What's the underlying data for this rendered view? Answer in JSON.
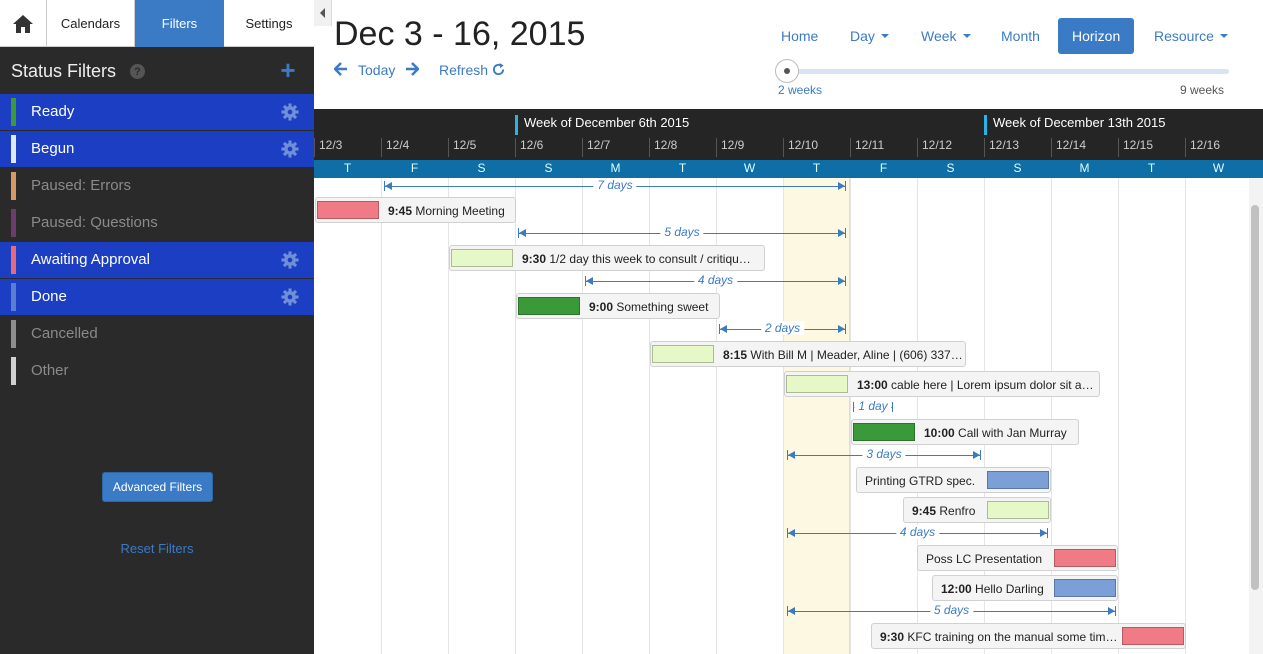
{
  "sidebar": {
    "tabs": {
      "calendars": "Calendars",
      "filters": "Filters",
      "settings": "Settings"
    },
    "status_title": "Status Filters",
    "filters": [
      {
        "label": "Ready",
        "color": "#3a9a3a",
        "active": true
      },
      {
        "label": "Begun",
        "color": "#dfe9f5",
        "active": true
      },
      {
        "label": "Paused: Errors",
        "color": "#d59a64",
        "active": false
      },
      {
        "label": "Paused: Questions",
        "color": "#6a3d6b",
        "active": false
      },
      {
        "label": "Awaiting Approval",
        "color": "#e66a7a",
        "active": true
      },
      {
        "label": "Done",
        "color": "#5a7fd0",
        "active": true
      },
      {
        "label": "Cancelled",
        "color": "#8e8e8e",
        "active": false
      },
      {
        "label": "Other",
        "color": "#d0d0d0",
        "active": false
      }
    ],
    "advanced_filters": "Advanced Filters",
    "reset_filters": "Reset Filters"
  },
  "header": {
    "date_range": "Dec 3 - 16, 2015",
    "today": "Today",
    "refresh": "Refresh",
    "nav": {
      "home": "Home",
      "day": "Day",
      "week": "Week",
      "month": "Month",
      "horizon": "Horizon",
      "resource": "Resource"
    },
    "slider": {
      "min_label": "2 weeks",
      "max_label": "9 weeks"
    }
  },
  "timeline": {
    "weeks": [
      "Week of December 6th 2015",
      "Week of December 13th 2015"
    ],
    "dates": [
      "12/3",
      "12/4",
      "12/5",
      "12/6",
      "12/7",
      "12/8",
      "12/9",
      "12/10",
      "12/11",
      "12/12",
      "12/13",
      "12/14",
      "12/15",
      "12/16"
    ],
    "days": [
      "T",
      "F",
      "S",
      "S",
      "M",
      "T",
      "W",
      "T",
      "F",
      "S",
      "S",
      "M",
      "T",
      "W"
    ],
    "spans": [
      "7 days",
      "5 days",
      "4 days",
      "2 days",
      "1 day",
      "3 days",
      "4 days",
      "5 days"
    ],
    "events": [
      {
        "time": "9:45",
        "title": "Morning Meeting",
        "color": "#f07a85"
      },
      {
        "time": "9:30",
        "title": "1/2 day this week to consult / critiqu…",
        "color": "#e6f8c8"
      },
      {
        "time": "9:00",
        "title": "Something sweet",
        "color": "#3a9a3a"
      },
      {
        "time": "8:15",
        "title": "With Bill M | Meader, Aline | (606) 337…",
        "color": "#e6f8c8"
      },
      {
        "time": "13:00",
        "title": "cable here | Lorem ipsum dolor sit a…",
        "color": "#e6f8c8"
      },
      {
        "time": "10:00",
        "title": "Call with Jan Murray",
        "color": "#3a9a3a"
      },
      {
        "time": "",
        "title": "Printing GTRD spec.",
        "color": "#7b9fd6"
      },
      {
        "time": "9:45",
        "title": "Renfro",
        "color": "#e6f8c8"
      },
      {
        "time": "",
        "title": "Poss LC Presentation",
        "color": "#f07a85"
      },
      {
        "time": "12:00",
        "title": "Hello Darling",
        "color": "#7b9fd6"
      },
      {
        "time": "9:30",
        "title": "KFC training on the manual some tim…",
        "color": "#f07a85"
      }
    ]
  }
}
